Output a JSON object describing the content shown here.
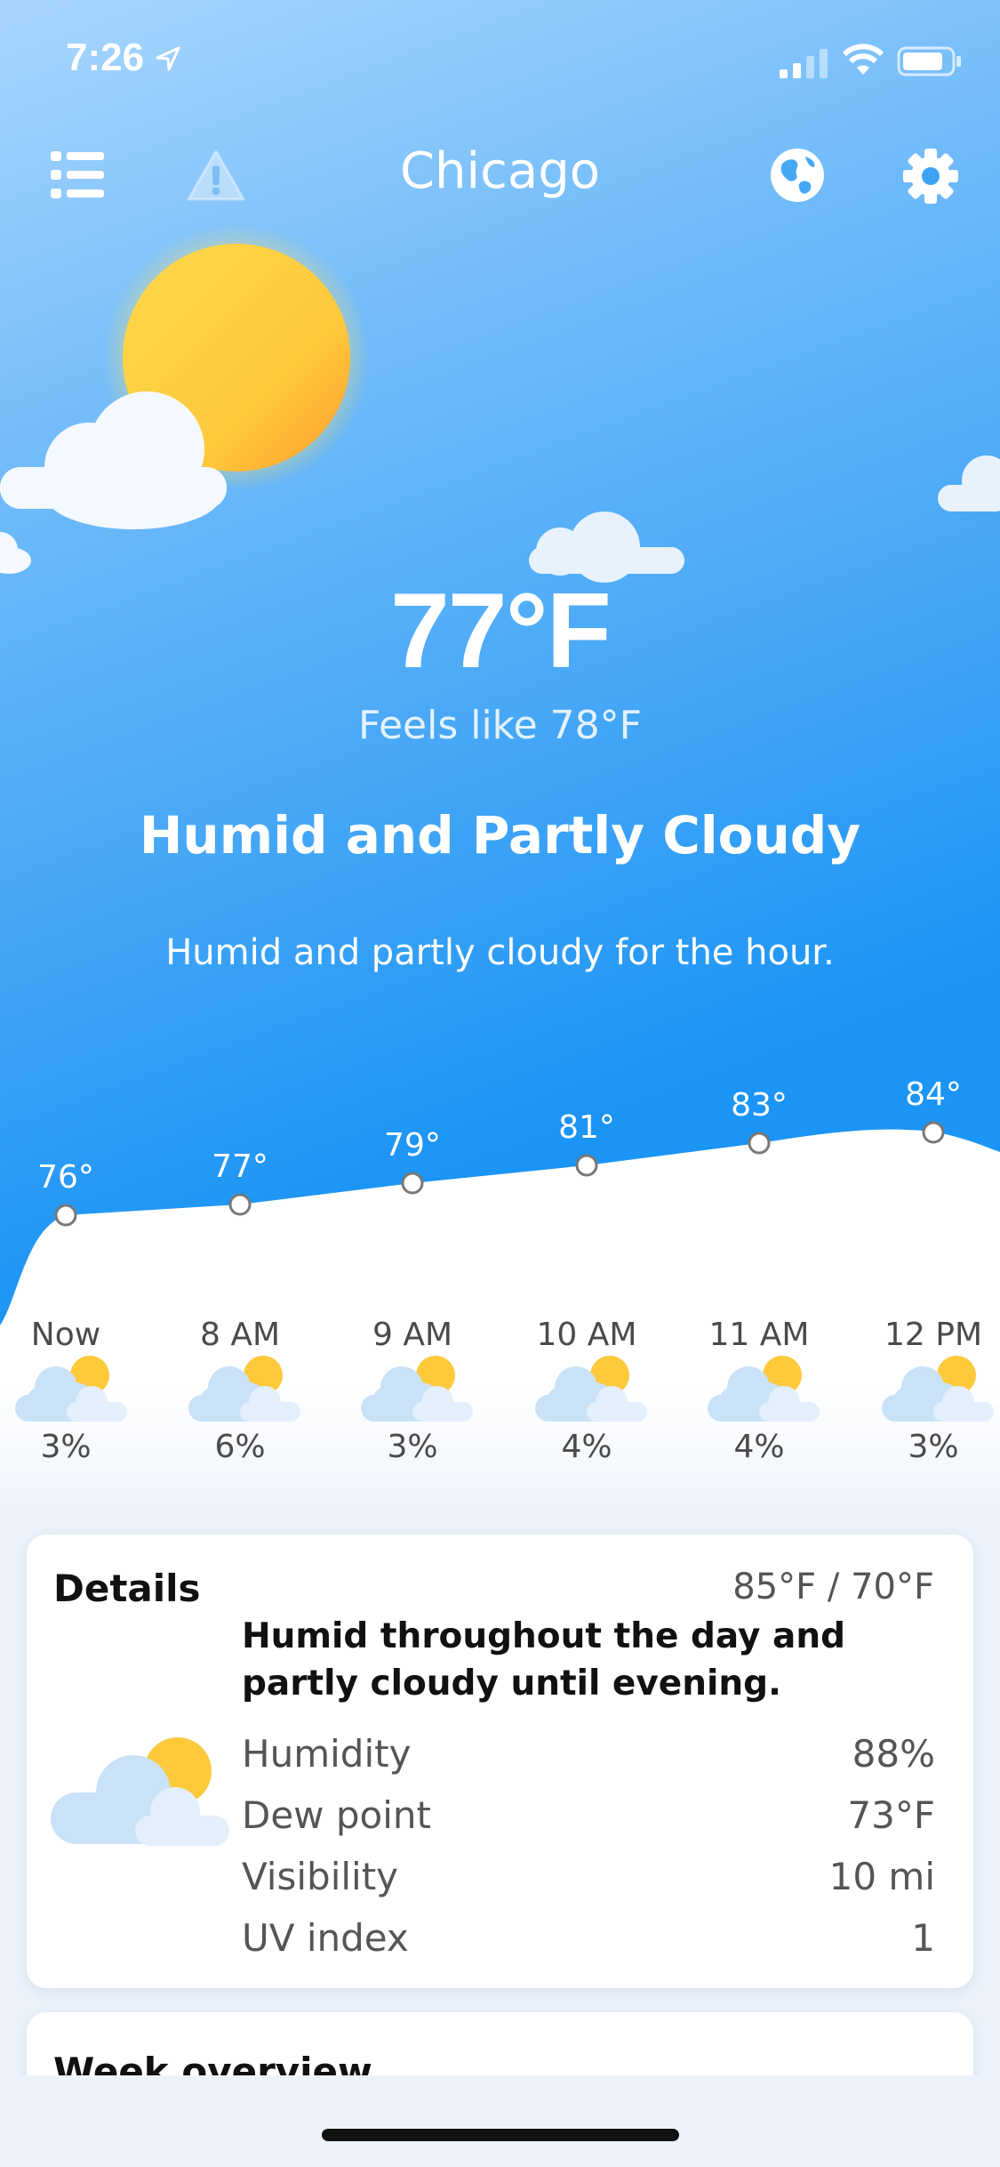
{
  "status_bar": {
    "time": "7:26"
  },
  "header": {
    "city": "Chicago"
  },
  "current": {
    "temperature": "77°F",
    "feels_like": "Feels like 78°F",
    "condition": "Humid and Partly Cloudy",
    "summary": "Humid and partly cloudy for the hour."
  },
  "hourly": [
    {
      "label": "Now",
      "temp": "76°",
      "precip": "3%"
    },
    {
      "label": "8 AM",
      "temp": "77°",
      "precip": "6%"
    },
    {
      "label": "9 AM",
      "temp": "79°",
      "precip": "3%"
    },
    {
      "label": "10 AM",
      "temp": "81°",
      "precip": "4%"
    },
    {
      "label": "11 AM",
      "temp": "83°",
      "precip": "4%"
    },
    {
      "label": "12 PM",
      "temp": "84°",
      "precip": "3%"
    }
  ],
  "details": {
    "title": "Details",
    "high_low": "85°F / 70°F",
    "summary": "Humid throughout the day and partly cloudy until evening.",
    "rows": [
      {
        "label": "Humidity",
        "value": "88%"
      },
      {
        "label": "Dew point",
        "value": "73°F"
      },
      {
        "label": "Visibility",
        "value": "10 mi"
      },
      {
        "label": "UV index",
        "value": "1"
      }
    ]
  },
  "week": {
    "title": "Week overview"
  },
  "icons": {
    "menu": "list-icon",
    "alert": "warning-icon",
    "map": "globe-icon",
    "settings": "gear-icon",
    "weather": "partly-cloudy-icon"
  },
  "colors": {
    "sky_top": "#a9d6fe",
    "sky_bottom": "#1a94f5",
    "sun": "#ffc93c",
    "cloud": "#c9e2f8"
  }
}
